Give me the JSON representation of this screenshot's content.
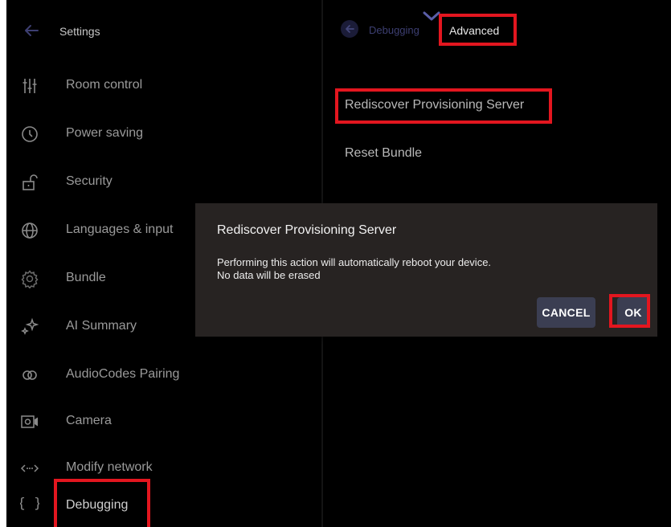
{
  "settings": {
    "title": "Settings",
    "items": [
      {
        "label": "Room control",
        "icon": "sliders-icon"
      },
      {
        "label": "Power saving",
        "icon": "clock-icon"
      },
      {
        "label": "Security",
        "icon": "unlock-icon"
      },
      {
        "label": "Languages & input",
        "icon": "globe-icon"
      },
      {
        "label": "Bundle",
        "icon": "gear-icon"
      },
      {
        "label": "AI Summary",
        "icon": "sparkle-icon"
      },
      {
        "label": "AudioCodes Pairing",
        "icon": "pairing-icon"
      },
      {
        "label": "Camera",
        "icon": "camera-icon"
      },
      {
        "label": "Modify network",
        "icon": "network-icon"
      },
      {
        "label": "Debugging",
        "icon": "braces-icon"
      }
    ]
  },
  "detail": {
    "breadcrumb_parent": "Debugging",
    "breadcrumb_current": "Advanced",
    "options": [
      "Rediscover Provisioning Server",
      "Reset Bundle"
    ]
  },
  "dialog": {
    "title": "Rediscover Provisioning Server",
    "message_line1": "Performing this action will automatically reboot your device.",
    "message_line2": "No data will be erased",
    "cancel_label": "CANCEL",
    "ok_label": "OK"
  },
  "colors": {
    "background": "#000000",
    "dialog_bg": "#272322",
    "button_bg": "#3b3e52",
    "highlight": "#e3161f",
    "breadcrumb_dim": "#3d3f72"
  }
}
